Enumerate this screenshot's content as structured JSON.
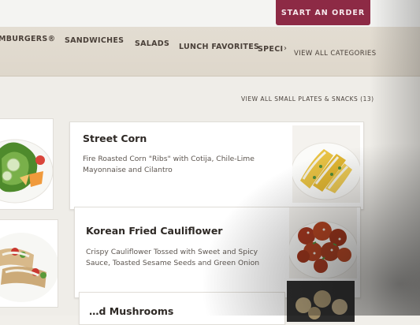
{
  "header": {
    "start_order": "START AN ORDER"
  },
  "categories": {
    "items": [
      "MBURGERS®",
      "SANDWICHES",
      "SALADS",
      "LUNCH FAVORITES",
      "SPECI"
    ],
    "view_all": "VIEW ALL CATEGORIES"
  },
  "section": {
    "view_all_link": "VIEW ALL SMALL PLATES & SNACKS (13)"
  },
  "cards": [
    {
      "title": "Street Corn",
      "description_line1": "Fire Roasted Corn \"Ribs\" with Cotija, Chile-Lime",
      "description_line2": "Mayonnaise and Cilantro"
    },
    {
      "title": "Korean Fried Cauliflower",
      "description_line1": "Crispy Cauliflower Tossed with Sweet and Spicy",
      "description_line2": "Sauce, Toasted Sesame Seeds and Green Onion"
    },
    {
      "title": "…d Mushrooms"
    }
  ],
  "colors": {
    "brand": "#8d2a45",
    "nav_band": "#e3ddd2",
    "page_bg": "#efede8"
  }
}
